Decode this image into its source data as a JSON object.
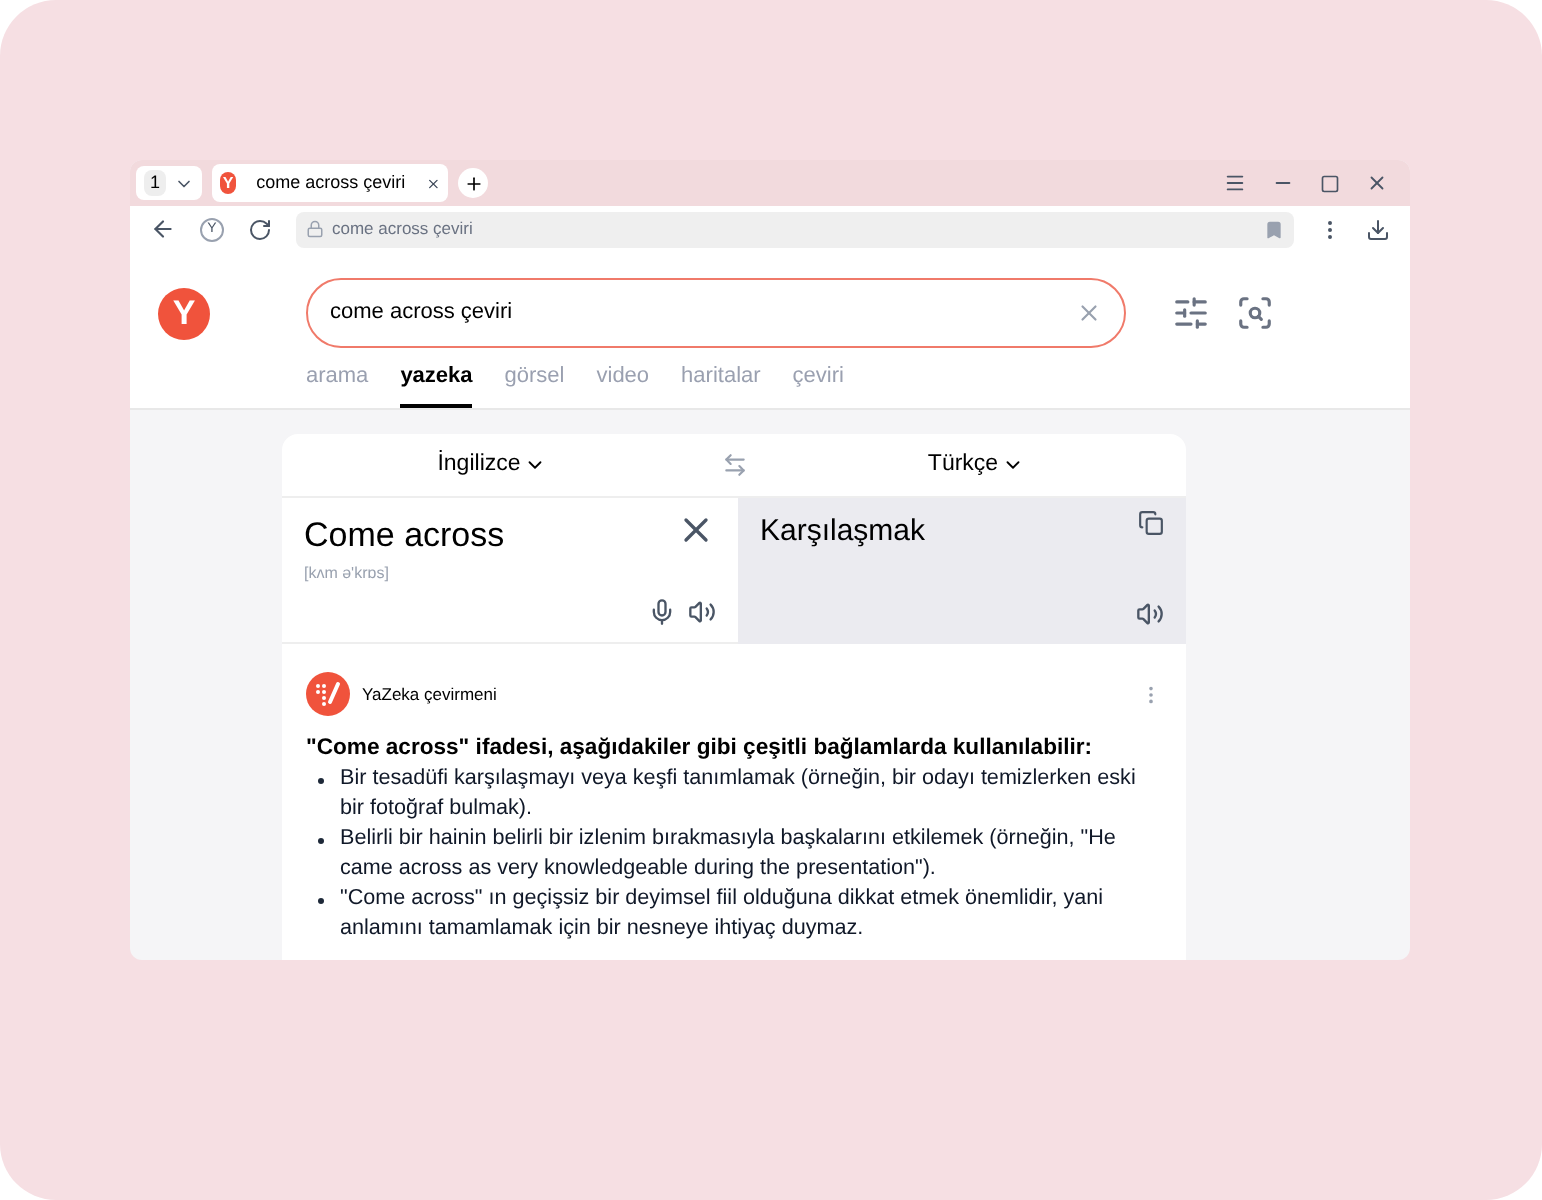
{
  "browser": {
    "tab_count": "1",
    "tab_favicon": "Y",
    "tab_title": "come across çeviri",
    "home_letter": "Y",
    "address": "come across çeviri"
  },
  "search": {
    "logo": "Y",
    "value": "come across çeviri"
  },
  "tabs": [
    {
      "label": "arama",
      "selected": false
    },
    {
      "label": "yazeka",
      "selected": true
    },
    {
      "label": "görsel",
      "selected": false
    },
    {
      "label": "video",
      "selected": false
    },
    {
      "label": "haritalar",
      "selected": false
    },
    {
      "label": "çeviri",
      "selected": false
    }
  ],
  "translator": {
    "source_lang": "İngilizce",
    "target_lang": "Türkçe",
    "source_text": "Come across",
    "transcription": "[kʌm ə'krɒs]",
    "translation": "Karşılaşmak"
  },
  "answer": {
    "source": "YaZeka çevirmeni",
    "heading": "\"Come across\" ifadesi, aşağıdakiler gibi çeşitli bağlamlarda kullanılabilir:",
    "bullets": [
      "Bir tesadüfi karşılaşmayı veya keşfi tanımlamak (örneğin, bir odayı temizlerken eski bir fotoğraf bulmak).",
      "Belirli bir hainin belirli bir izlenim bırakmasıyla başkalarını etkilemek (örneğin, \"He came across as very knowledgeable during the presentation\").",
      "\"Come across\" ın geçişsiz bir deyimsel fiil olduğuna dikkat etmek önemlidir, yani anlamını tamamlamak için bir nesneye ihtiyaç duymaz."
    ]
  }
}
